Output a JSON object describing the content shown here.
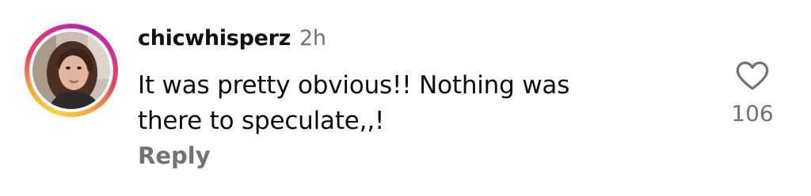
{
  "comment": {
    "username": "chicwhisperz",
    "timestamp": "2h",
    "text_line_1": "It was pretty obvious!! Nothing was",
    "text_line_2": "there to speculate,,!",
    "reply_label": "Reply",
    "like_count": "106",
    "avatar_icon": "profile-photo",
    "like_icon": "heart-outline",
    "colors": {
      "username": "#111111",
      "secondary_text": "#737373",
      "story_ring_start": "#fdd33c",
      "story_ring_mid": "#f0415a",
      "story_ring_end": "#b124b8"
    }
  }
}
